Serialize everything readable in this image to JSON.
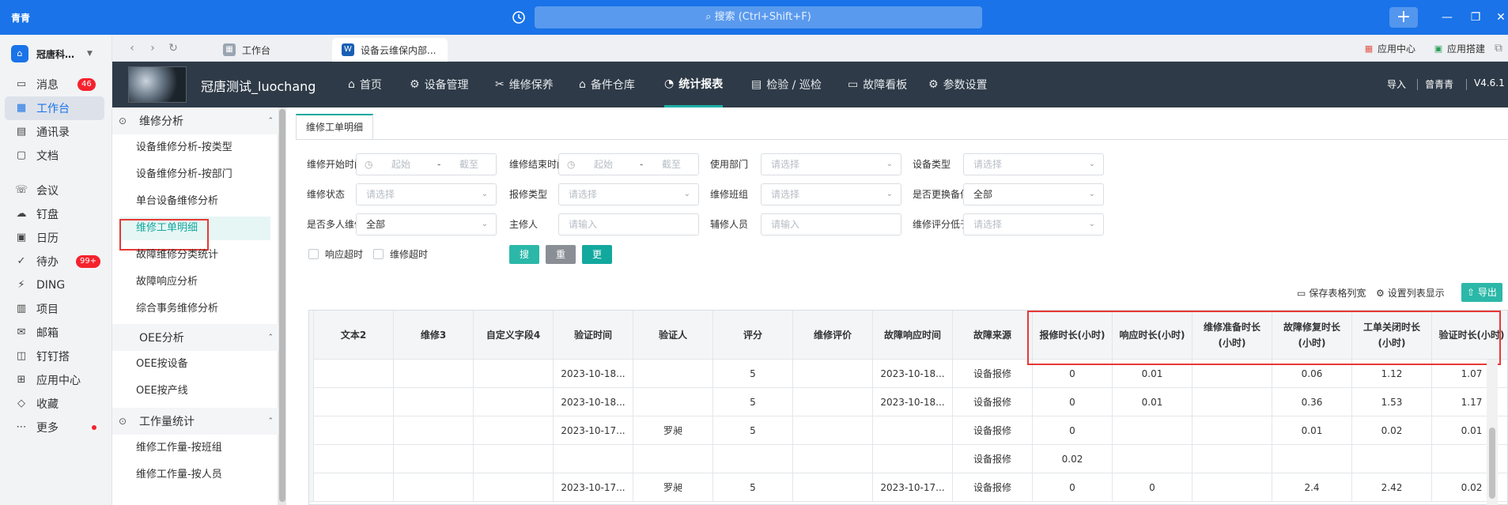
{
  "titlebar": {
    "app_name": "青青",
    "search_placeholder": "搜索 (Ctrl+Shift+F)",
    "plus": "+",
    "minimize": "—",
    "restore": "❐",
    "close": "✕"
  },
  "sidebar": {
    "org_name": "冠唐科…",
    "items": [
      {
        "label": "消息",
        "icon": "message-icon",
        "badge": "46"
      },
      {
        "label": "工作台",
        "icon": "workbench-icon",
        "active": true
      },
      {
        "label": "通讯录",
        "icon": "contacts-icon"
      },
      {
        "label": "文档",
        "icon": "document-icon"
      },
      {
        "label": "会议",
        "icon": "meeting-icon"
      },
      {
        "label": "钉盘",
        "icon": "cloud-disk-icon"
      },
      {
        "label": "日历",
        "icon": "calendar-icon"
      },
      {
        "label": "待办",
        "icon": "todo-icon",
        "badge": "99+"
      },
      {
        "label": "DING",
        "icon": "ding-icon"
      },
      {
        "label": "项目",
        "icon": "project-icon"
      },
      {
        "label": "邮箱",
        "icon": "mail-icon"
      },
      {
        "label": "钉钉搭",
        "icon": "builder-icon"
      },
      {
        "label": "应用中心",
        "icon": "app-center-icon"
      },
      {
        "label": "收藏",
        "icon": "favorite-icon"
      },
      {
        "label": "更多",
        "icon": "more-icon"
      }
    ]
  },
  "browser_tabs": {
    "tabs": [
      {
        "label": "工作台"
      },
      {
        "label": "设备云维保内部..."
      }
    ],
    "right_links": [
      "应用中心",
      "应用搭建"
    ]
  },
  "app_header": {
    "system_name": "冠唐测试_luochang",
    "menu": [
      {
        "label": "首页",
        "icon": "home-icon"
      },
      {
        "label": "设备管理",
        "icon": "device-icon"
      },
      {
        "label": "维修保养",
        "icon": "wrench-icon"
      },
      {
        "label": "备件仓库",
        "icon": "warehouse-icon"
      },
      {
        "label": "统计报表",
        "icon": "chart-icon",
        "active": true
      },
      {
        "label": "检验 / 巡检",
        "icon": "inspection-icon"
      },
      {
        "label": "故障看板",
        "icon": "board-icon"
      },
      {
        "label": "参数设置",
        "icon": "settings-icon"
      }
    ],
    "import_label": "导入",
    "user": "曾青青",
    "version": "V4.6.1"
  },
  "module_menu": {
    "groups": [
      {
        "title": "维修分析",
        "items": [
          "设备维修分析-按类型",
          "设备维修分析-按部门",
          "单台设备维修分析",
          "维修工单明细",
          "故障维修分类统计",
          "故障响应分析",
          "综合事务维修分析"
        ]
      },
      {
        "title": "OEE分析",
        "items": [
          "OEE按设备",
          "OEE按产线"
        ]
      },
      {
        "title": "工作量统计",
        "items": [
          "维修工作量-按班组",
          "维修工作量-按人员"
        ]
      }
    ],
    "active_item": "维修工单明细"
  },
  "content": {
    "tab_label": "维修工单明细",
    "filters": {
      "repair_start_label": "维修开始时间",
      "repair_end_label": "维修结束时间",
      "range_start": "起始",
      "range_dash": "-",
      "range_end": "截至",
      "dept_label": "使用部门",
      "device_type_label": "设备类型",
      "status_label": "维修状态",
      "report_type_label": "报修类型",
      "team_label": "维修班组",
      "spare_label": "是否更换备件",
      "spare_value": "全部",
      "multi_label": "是否多人维修",
      "multi_value": "全部",
      "main_repair_label": "主修人",
      "assist_label": "辅修人员",
      "score_label": "维修评分低于",
      "select_placeholder": "请选择",
      "input_placeholder": "请输入",
      "resp_timeout": "响应超时",
      "repair_timeout": "维修超时",
      "search_btn": "搜索",
      "reset_btn": "重置",
      "more_btn": "更多"
    },
    "toolbar": {
      "save_width": "保存表格列宽",
      "set_columns": "设置列表显示",
      "export": "导出"
    }
  },
  "table": {
    "headers": [
      "文本2",
      "维修3",
      "自定义字段4",
      "验证时间",
      "验证人",
      "评分",
      "维修评价",
      "故障响应时间",
      "故障来源",
      "报修时长(小时)",
      "响应时长(小时)",
      "维修准备时长(小时)",
      "故障修复时长(小时)",
      "工单关闭时长(小时)",
      "验证时长(小时)"
    ],
    "rows": [
      [
        "",
        "",
        "",
        "2023-10-18...",
        "",
        "5",
        "",
        "2023-10-18...",
        "设备报修",
        "0",
        "0.01",
        "",
        "0.06",
        "1.12",
        "1.07"
      ],
      [
        "",
        "",
        "",
        "2023-10-18...",
        "",
        "5",
        "",
        "2023-10-18...",
        "设备报修",
        "0",
        "0.01",
        "",
        "0.36",
        "1.53",
        "1.17"
      ],
      [
        "",
        "",
        "",
        "2023-10-17...",
        "罗昶",
        "5",
        "",
        "",
        "设备报修",
        "0",
        "",
        "",
        "0.01",
        "0.02",
        "0.01"
      ],
      [
        "",
        "",
        "",
        "",
        "",
        "",
        "",
        "",
        "设备报修",
        "0.02",
        "",
        "",
        "",
        "",
        ""
      ],
      [
        "",
        "",
        "",
        "2023-10-17...",
        "罗昶",
        "5",
        "",
        "2023-10-17...",
        "设备报修",
        "0",
        "0",
        "",
        "2.4",
        "2.42",
        "0.02"
      ]
    ]
  }
}
